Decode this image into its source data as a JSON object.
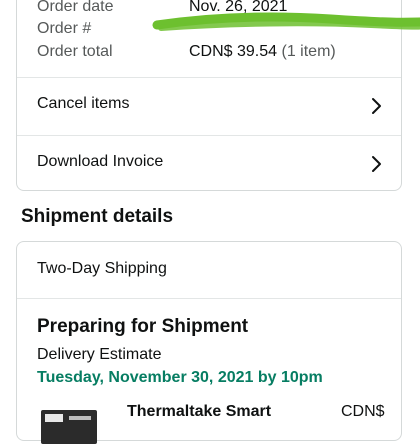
{
  "order": {
    "date_label": "Order date",
    "date_value": "Nov. 26, 2021",
    "number_label": "Order #",
    "total_label": "Order total",
    "total_amount": "CDN$ 39.54",
    "total_items": "(1 item)"
  },
  "actions": [
    {
      "label": "Cancel items"
    },
    {
      "label": "Download Invoice"
    }
  ],
  "shipment": {
    "title": "Shipment details",
    "method": "Two-Day Shipping",
    "status": "Preparing for Shipment",
    "estimate_label": "Delivery Estimate",
    "estimate_value": "Tuesday, November 30, 2021 by 10pm",
    "item_name": "Thermaltake Smart",
    "item_price": "CDN$"
  },
  "colors": {
    "green_text": "#067d62",
    "redaction": "#6dc02f",
    "border": "#d5d9d9"
  }
}
